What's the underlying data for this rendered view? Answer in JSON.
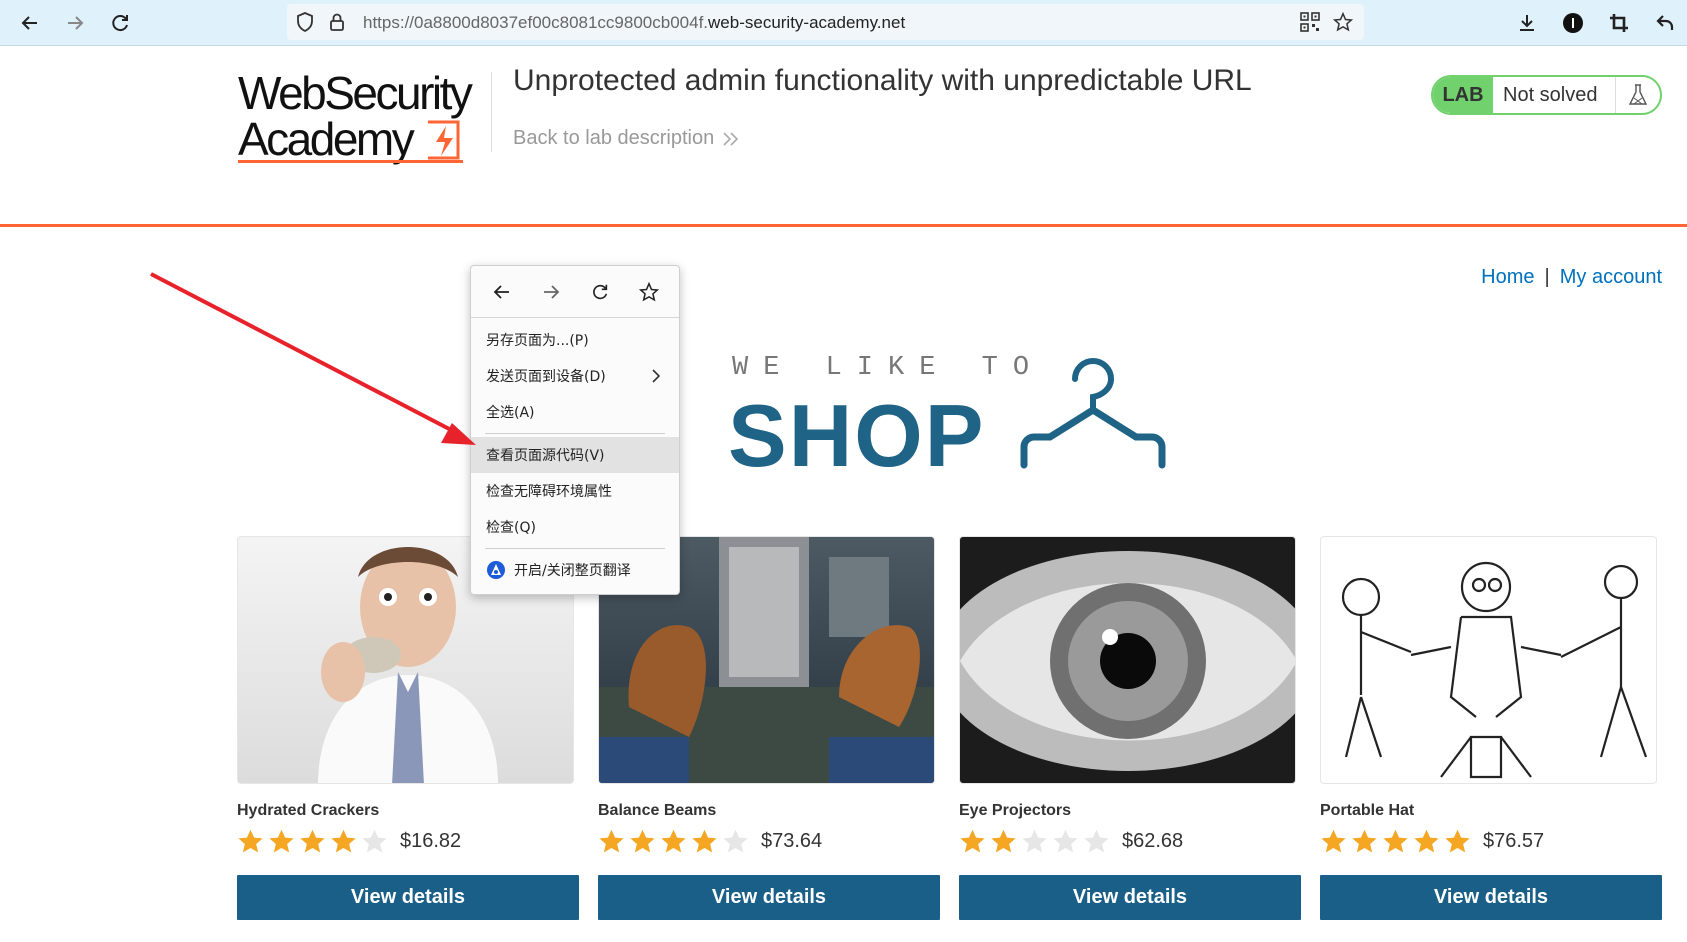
{
  "browser": {
    "url_prefix": "https://0a8800d8037ef00c8081cc9800cb004f.",
    "url_domain": "web-security-academy.net"
  },
  "lab": {
    "logo_line1": "WebSecurity",
    "logo_line2": "Academy",
    "title": "Unprotected admin functionality with unpredictable URL",
    "back_link": "Back to lab description",
    "status_tag": "LAB",
    "status_text": "Not solved"
  },
  "nav": {
    "home": "Home",
    "separator": "|",
    "account": "My account"
  },
  "banner": {
    "small": "WE LIKE TO",
    "big": "SHOP"
  },
  "products": [
    {
      "name": "Hydrated Crackers",
      "rating": 4,
      "price": "$16.82",
      "button": "View details"
    },
    {
      "name": "Balance Beams",
      "rating": 4,
      "price": "$73.64",
      "button": "View details"
    },
    {
      "name": "Eye Projectors",
      "rating": 2,
      "price": "$62.68",
      "button": "View details"
    },
    {
      "name": "Portable Hat",
      "rating": 5,
      "price": "$76.57",
      "button": "View details"
    }
  ],
  "context_menu": {
    "items": [
      {
        "label": "另存页面为...(P)"
      },
      {
        "label": "发送页面到设备(D)"
      },
      {
        "label": "全选(A)"
      },
      {
        "label": "查看页面源代码(V)"
      },
      {
        "label": "检查无障碍环境属性"
      },
      {
        "label": "检查(Q)"
      },
      {
        "label": "开启/关闭整页翻译"
      }
    ]
  },
  "colors": {
    "accent_orange": "#ff6633",
    "brand_blue": "#1a5f87",
    "link_blue": "#0071bc",
    "status_green": "#70d16d",
    "star_gold": "#f5a623",
    "annotation_red": "#e8222a"
  }
}
